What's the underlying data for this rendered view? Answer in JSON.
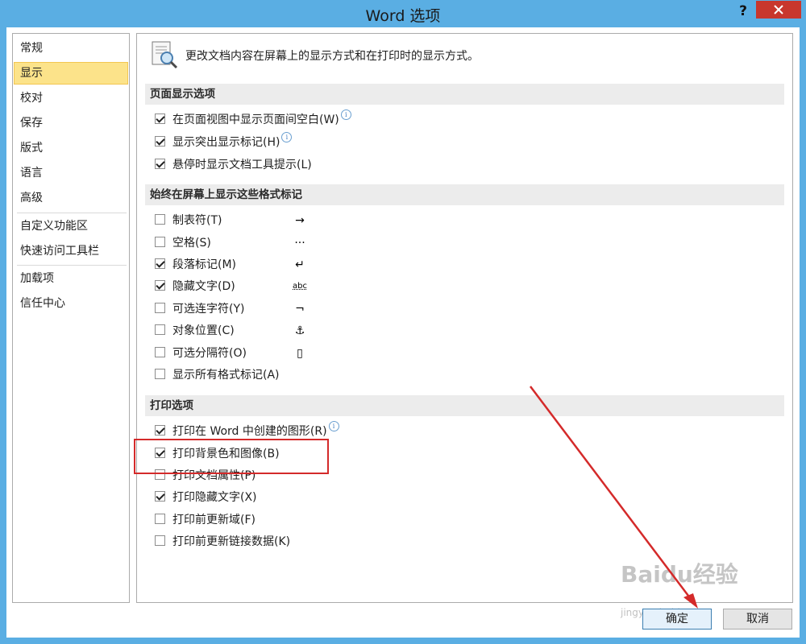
{
  "window": {
    "title": "Word 选项",
    "help_label": "?"
  },
  "nav": {
    "items": [
      {
        "label": "常规"
      },
      {
        "label": "显示"
      },
      {
        "label": "校对"
      },
      {
        "label": "保存"
      },
      {
        "label": "版式"
      },
      {
        "label": "语言"
      },
      {
        "label": "高级"
      },
      {
        "label": "自定义功能区"
      },
      {
        "label": "快速访问工具栏"
      },
      {
        "label": "加载项"
      },
      {
        "label": "信任中心"
      }
    ],
    "selected": "显示"
  },
  "header": {
    "description": "更改文档内容在屏幕上的显示方式和在打印时的显示方式。",
    "icon": "document-magnifier-icon"
  },
  "sections": {
    "page_display": {
      "title": "页面显示选项",
      "options": [
        {
          "label": "在页面视图中显示页面间空白(W)",
          "checked": true,
          "info": true
        },
        {
          "label": "显示突出显示标记(H)",
          "checked": true,
          "info": true
        },
        {
          "label": "悬停时显示文档工具提示(L)",
          "checked": true,
          "info": false
        }
      ]
    },
    "format_marks": {
      "title": "始终在屏幕上显示这些格式标记",
      "options": [
        {
          "label": "制表符(T)",
          "checked": false,
          "mark": "→"
        },
        {
          "label": "空格(S)",
          "checked": false,
          "mark": "···"
        },
        {
          "label": "段落标记(M)",
          "checked": true,
          "mark": "↵"
        },
        {
          "label": "隐藏文字(D)",
          "checked": true,
          "mark": "abc"
        },
        {
          "label": "可选连字符(Y)",
          "checked": false,
          "mark": "¬"
        },
        {
          "label": "对象位置(C)",
          "checked": false,
          "mark": "⚓"
        },
        {
          "label": "可选分隔符(O)",
          "checked": false,
          "mark": "▯"
        },
        {
          "label": "显示所有格式标记(A)",
          "checked": false,
          "mark": ""
        }
      ]
    },
    "print": {
      "title": "打印选项",
      "options": [
        {
          "label": "打印在 Word 中创建的图形(R)",
          "checked": true,
          "info": true
        },
        {
          "label": "打印背景色和图像(B)",
          "checked": true,
          "info": false
        },
        {
          "label": "打印文档属性(P)",
          "checked": false,
          "info": false
        },
        {
          "label": "打印隐藏文字(X)",
          "checked": true,
          "info": false
        },
        {
          "label": "打印前更新域(F)",
          "checked": false,
          "info": false
        },
        {
          "label": "打印前更新链接数据(K)",
          "checked": false,
          "info": false
        }
      ]
    }
  },
  "buttons": {
    "ok": "确定",
    "cancel": "取消"
  },
  "watermark": {
    "brand": "Baidu经验",
    "url": "jingyan.baidu.com"
  },
  "colors": {
    "title_bar": "#5aaee3",
    "close_button": "#c8372d",
    "nav_selected": "#fce38a",
    "highlight": "#d42a2a"
  }
}
